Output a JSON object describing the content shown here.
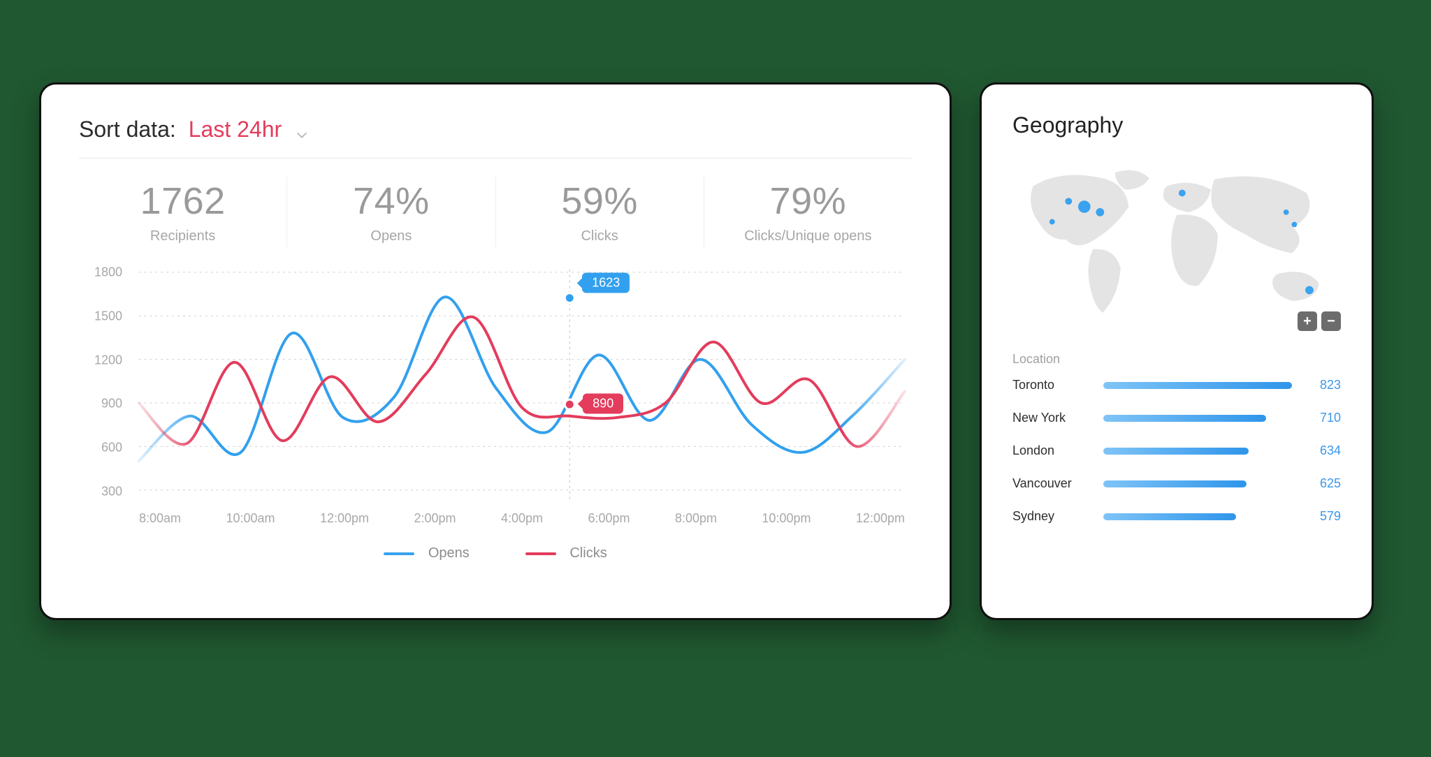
{
  "analytics": {
    "sort_label": "Sort data:",
    "sort_value": "Last 24hr",
    "metrics": [
      {
        "value": "1762",
        "label": "Recipients"
      },
      {
        "value": "74%",
        "label": "Opens"
      },
      {
        "value": "59%",
        "label": "Clicks"
      },
      {
        "value": "79%",
        "label": "Clicks/Unique opens"
      }
    ],
    "legend": {
      "opens": "Opens",
      "clicks": "Clicks"
    },
    "tooltip": {
      "opens": "1623",
      "clicks": "890"
    }
  },
  "geography": {
    "title": "Geography",
    "location_header": "Location",
    "locations": [
      {
        "name": "Toronto",
        "value": 823
      },
      {
        "name": "New York",
        "value": 710
      },
      {
        "name": "London",
        "value": 634
      },
      {
        "name": "Vancouver",
        "value": 625
      },
      {
        "name": "Sydney",
        "value": 579
      }
    ]
  },
  "chart_data": [
    {
      "type": "line",
      "title": "",
      "xlabel": "",
      "ylabel": "",
      "ylim": [
        300,
        1800
      ],
      "y_ticks": [
        300,
        600,
        900,
        1200,
        1500,
        1800
      ],
      "x_categories": [
        "8:00am",
        "10:00am",
        "12:00pm",
        "2:00pm",
        "4:00pm",
        "6:00pm",
        "8:00pm",
        "10:00pm",
        "12:00pm"
      ],
      "highlight_x_index": 4.5,
      "tooltips": {
        "Opens": 1623,
        "Clicks": 890
      },
      "series": [
        {
          "name": "Opens",
          "color": "#32a0ee",
          "values": [
            500,
            810,
            560,
            1380,
            800,
            940,
            1630,
            1000,
            700,
            1230,
            780,
            1200,
            750,
            560,
            820,
            1200
          ]
        },
        {
          "name": "Clicks",
          "color": "#e33c5c",
          "values": [
            900,
            620,
            1180,
            640,
            1080,
            770,
            1100,
            1490,
            870,
            810,
            800,
            900,
            1320,
            900,
            1060,
            600,
            980
          ]
        }
      ],
      "note": "values are evenly spaced samples left→right across the plotted range; estimated from gridlines"
    },
    {
      "type": "bar",
      "title": "Geography — Location",
      "categories": [
        "Toronto",
        "New York",
        "London",
        "Vancouver",
        "Sydney"
      ],
      "values": [
        823,
        710,
        634,
        625,
        579
      ]
    }
  ]
}
